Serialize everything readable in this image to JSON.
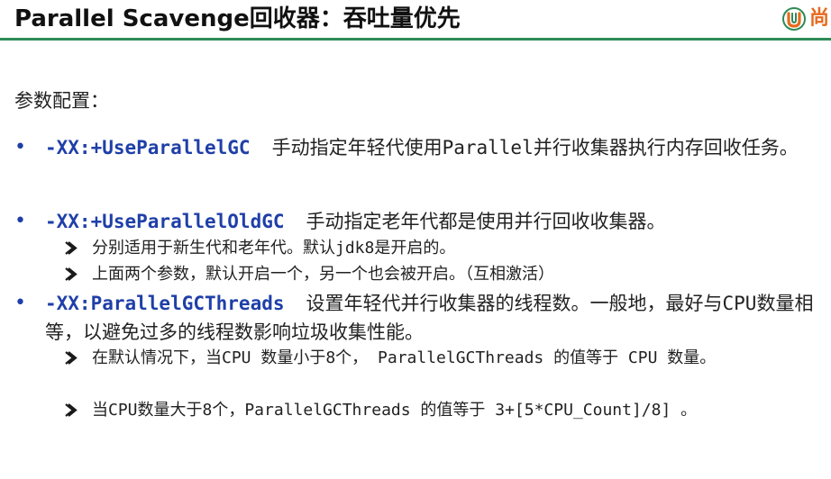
{
  "header": {
    "title": "Parallel Scavenge回收器：吞吐量优先",
    "logo_text": "尚",
    "accent_color": "#2e8b57",
    "logo_color": "#e66a1e"
  },
  "intro": "参数配置：",
  "items": [
    {
      "param": "-XX:+UseParallelGC",
      "text": "手动指定年轻代使用Parallel并行收集器执行内存回收任务。",
      "subs": []
    },
    {
      "param": "-XX:+UseParallelOldGC",
      "text": "手动指定老年代都是使用并行回收收集器。",
      "subs": [
        "分别适用于新生代和老年代。默认jdk8是开启的。",
        "上面两个参数，默认开启一个，另一个也会被开启。（互相激活）"
      ]
    },
    {
      "param": "-XX:ParallelGCThreads",
      "text": "设置年轻代并行收集器的线程数。一般地，最好与CPU数量相等，以避免过多的线程数影响垃圾收集性能。",
      "subs": [
        "在默认情况下，当CPU 数量小于8个， ParallelGCThreads 的值等于 CPU 数量。",
        "当CPU数量大于8个，ParallelGCThreads 的值等于 3+[5*CPU_Count]/8] 。"
      ]
    }
  ],
  "icons": {
    "bullet": "bullet-dot-icon",
    "sub_bullet": "arrow-right-icon",
    "logo": "logo-icon"
  }
}
